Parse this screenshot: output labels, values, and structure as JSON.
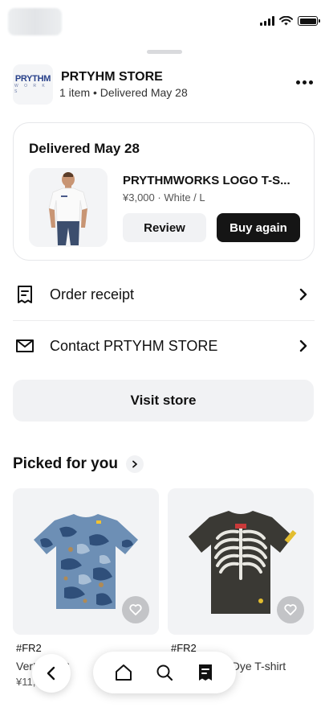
{
  "store": {
    "name": "PRTYHM STORE",
    "meta": "1 item • Delivered May 28",
    "logo_word": "PRYTHM",
    "logo_sub": "W O R K S"
  },
  "order": {
    "status": "Delivered May 28",
    "product_title": "PRYTHMWORKS LOGO T-S...",
    "product_detail": "¥3,000 · White / L",
    "review_label": "Review",
    "buy_again_label": "Buy again"
  },
  "menu": {
    "items": [
      {
        "label": "Order receipt",
        "icon": "receipt-icon"
      },
      {
        "label": "Contact PRTYHM STORE",
        "icon": "envelope-icon"
      }
    ]
  },
  "visit_store_label": "Visit store",
  "picked": {
    "title": "Picked for you",
    "items": [
      {
        "brand": "#FR2",
        "name": "Ver▯▯ert C",
        "price": "¥11,",
        "image": "blue-camo-tshirt"
      },
      {
        "brand": "#FR2",
        "name": "▯▯ent Dye T-shirt",
        "price": "",
        "image": "black-skeleton-tshirt"
      }
    ]
  },
  "nav": {
    "items": [
      "home-icon",
      "search-icon",
      "orders-icon"
    ],
    "active": "orders-icon"
  },
  "colors": {
    "primary_button": "#151515",
    "secondary_button": "#f1f2f4",
    "logo_blue": "#28418a"
  }
}
